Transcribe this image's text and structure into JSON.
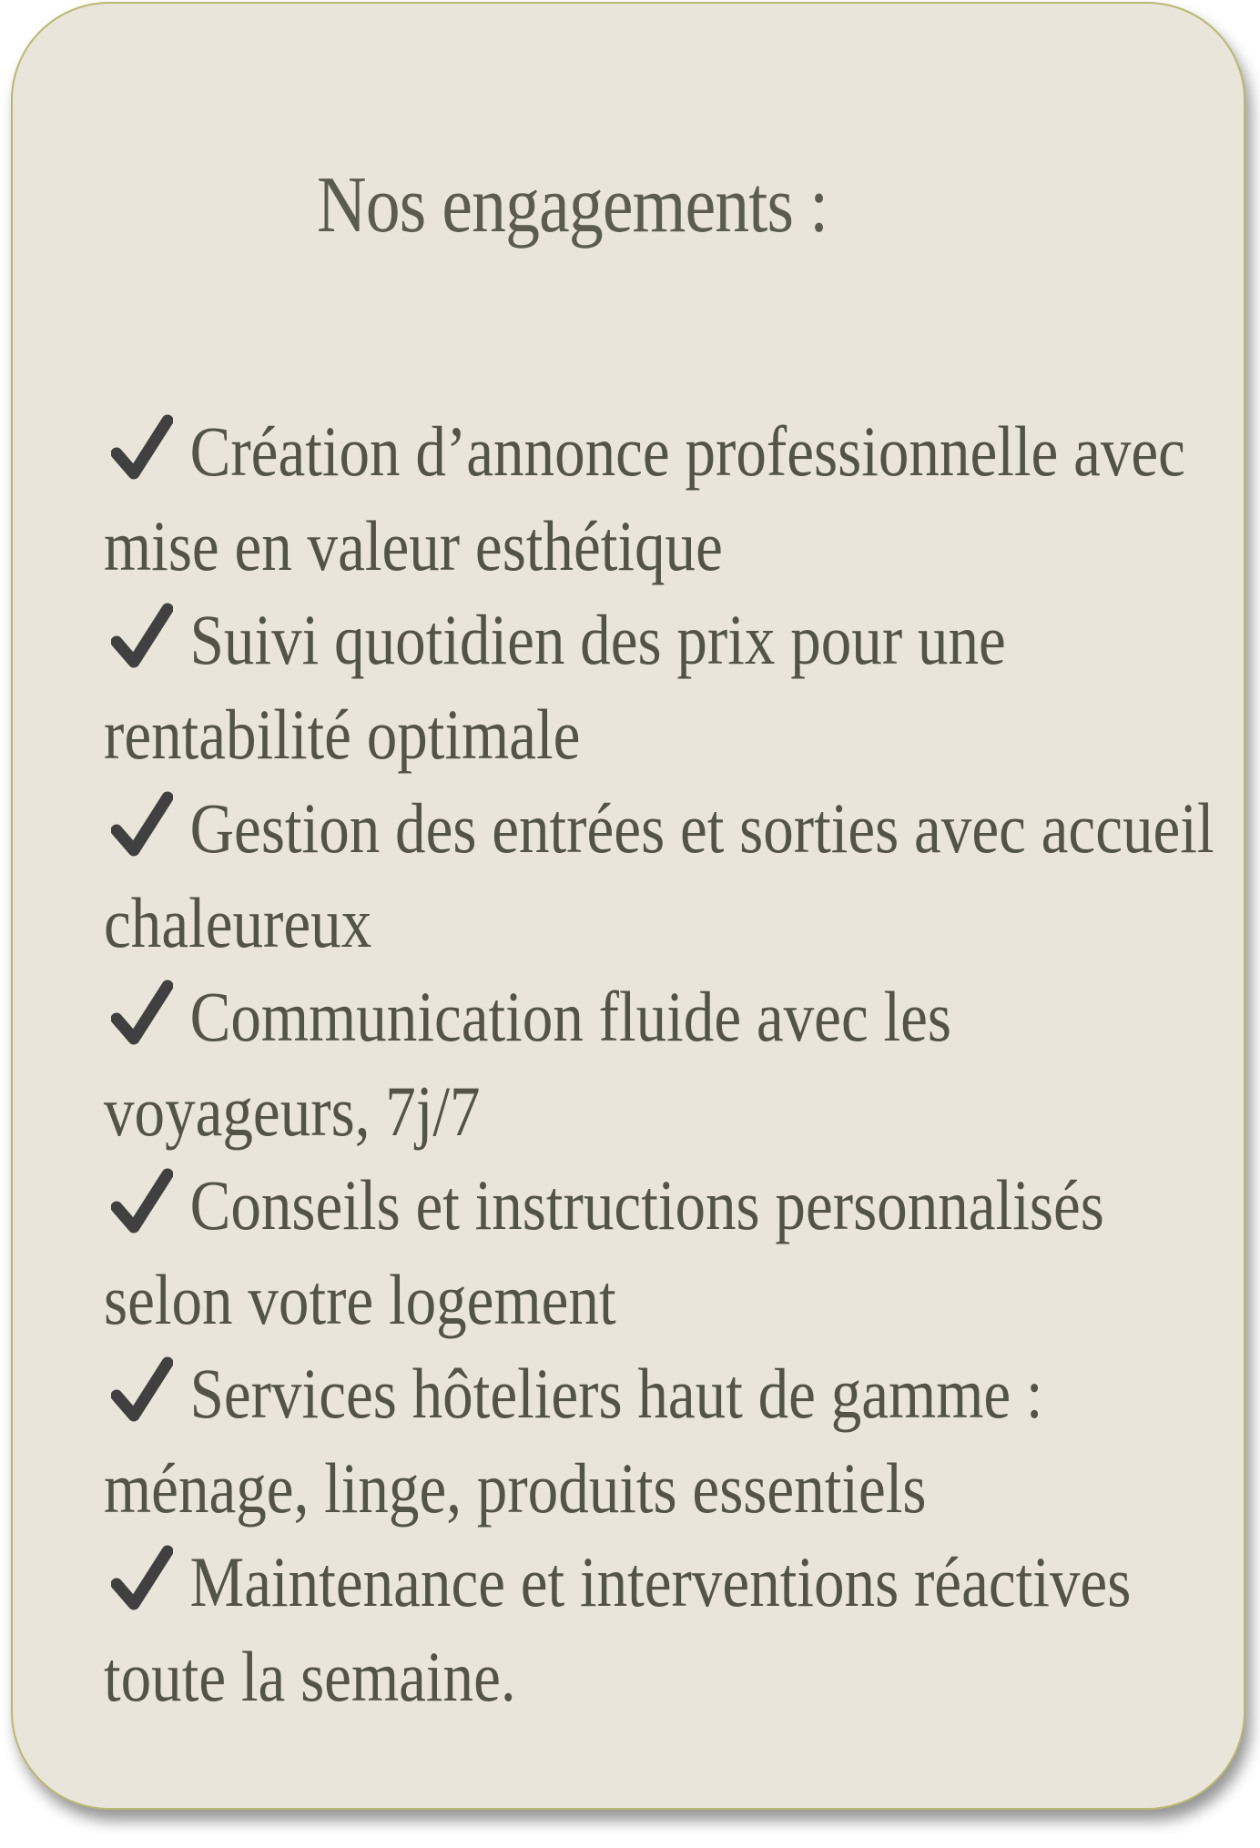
{
  "card": {
    "title": "Nos engagements :",
    "items": [
      {
        "icon": "checkmark-icon",
        "line1": "Création d’annonce professionnelle avec",
        "line2": "mise en valeur esthétique"
      },
      {
        "icon": "checkmark-icon",
        "line1": "Suivi quotidien des prix pour une",
        "line2": "rentabilité optimale"
      },
      {
        "icon": "checkmark-icon",
        "line1": "Gestion des entrées et sorties avec accueil",
        "line2": "chaleureux"
      },
      {
        "icon": "checkmark-icon",
        "line1": "Communication fluide avec les",
        "line2": "voyageurs, 7j/7"
      },
      {
        "icon": "checkmark-icon",
        "line1": "Conseils et instructions personnalisés",
        "line2": "selon votre logement"
      },
      {
        "icon": "checkmark-icon",
        "line1": "Services hôteliers haut de gamme :",
        "line2": "ménage, linge, produits essentiels"
      },
      {
        "icon": "checkmark-icon",
        "line1": "Maintenance et interventions réactives",
        "line2": "toute la semaine."
      }
    ]
  },
  "colors": {
    "background": "#e9e5da",
    "border": "#b9b870",
    "title_text": "#5b5b50",
    "body_text": "#535348",
    "checkmark": "#3f403f"
  }
}
